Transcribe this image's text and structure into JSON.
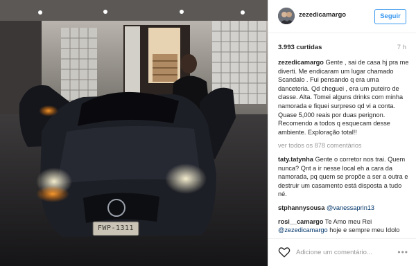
{
  "post": {
    "username": "zezedicamargo",
    "follow_label": "Seguir",
    "likes": "3.993 curtidas",
    "age": "7 h",
    "license_plate": "FWP-1311"
  },
  "comments": [
    {
      "user": "zezedicamargo",
      "text": "Gente , sai de casa hj pra me diverti. Me endicaram um lugar chamado Scandalo . Fui pensando q era uma danceteria. Qd cheguei , era um puteiro de classe. Alta. Tomei alguns drinks com minha namorada e fiquei surpreso qd vi a conta. Quase 5,000 reais por duas perignon. Recomendo a todos q esquecam desse ambiente. Exploração total!!"
    },
    {
      "more": "ver todos os 878 comentários"
    },
    {
      "user": "taty.tatynha",
      "text": "Gente o corretor nos trai. Quem nunca? Qnt a ir nesse local eh a cara da namorada, pq quem se propõe a ser a outra e destruir um casamento está disposta a tudo né."
    },
    {
      "user": "stphannysousa",
      "mention": "@vanessaprin13"
    },
    {
      "user": "rosi__camargo",
      "text_before": "Te Amo meu Rei",
      "mention": "@zezedicamargo",
      "text_after": "hoje e sempre meu Idolo querido"
    }
  ],
  "footer": {
    "comment_placeholder": "Adicione um comentário...",
    "more_icon": "more-options-icon"
  },
  "icons": [
    "heart-icon",
    "avatar",
    "more-options-icon"
  ],
  "colors": {
    "accent": "#3897f0",
    "text": "#262626",
    "muted": "#999999",
    "mention": "#003569"
  }
}
